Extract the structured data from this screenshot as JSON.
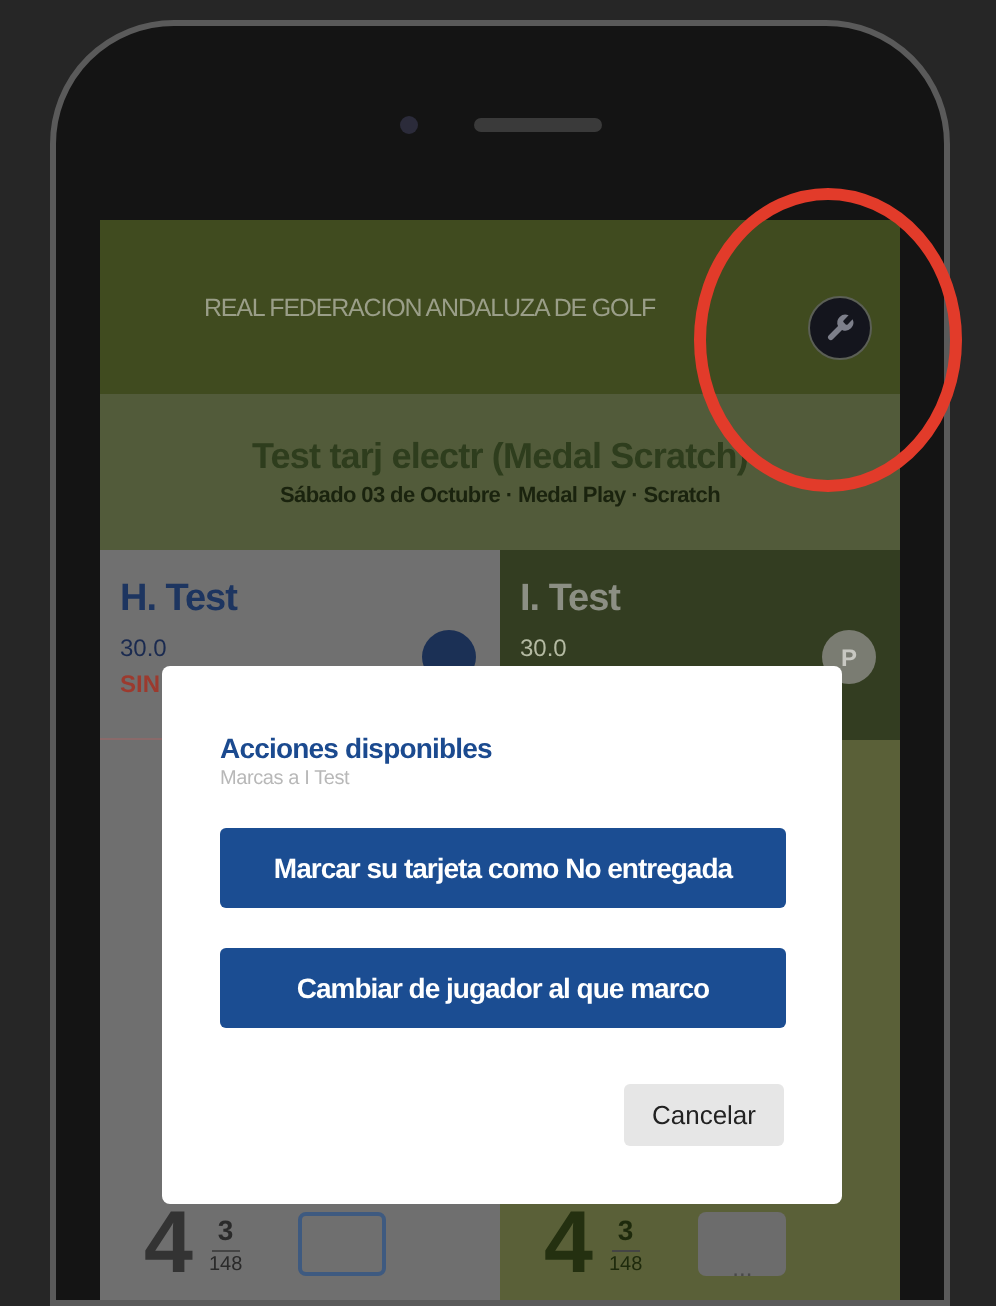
{
  "header": {
    "title": "REAL FEDERACION ANDALUZA DE GOLF"
  },
  "competition": {
    "title": "Test tarj electr (Medal Scratch)",
    "subtitle": "Sábado 03 de Octubre · Medal Play · Scratch"
  },
  "players": [
    {
      "name": "H. Test",
      "handicap": "30.0",
      "status": "SIN",
      "selected": true,
      "hole": {
        "par": "4",
        "index": "3",
        "length": "148"
      }
    },
    {
      "name": "I. Test",
      "handicap": "30.0",
      "badge": "P",
      "selected": false,
      "hole": {
        "par": "4",
        "index": "3",
        "length": "148",
        "dots": "..."
      }
    }
  ],
  "dialog": {
    "title": "Acciones disponibles",
    "subtitle": "Marcas a I Test",
    "actions": [
      "Marcar su tarjeta como No entregada",
      "Cambiar de jugador al que marco"
    ],
    "cancel": "Cancelar"
  }
}
